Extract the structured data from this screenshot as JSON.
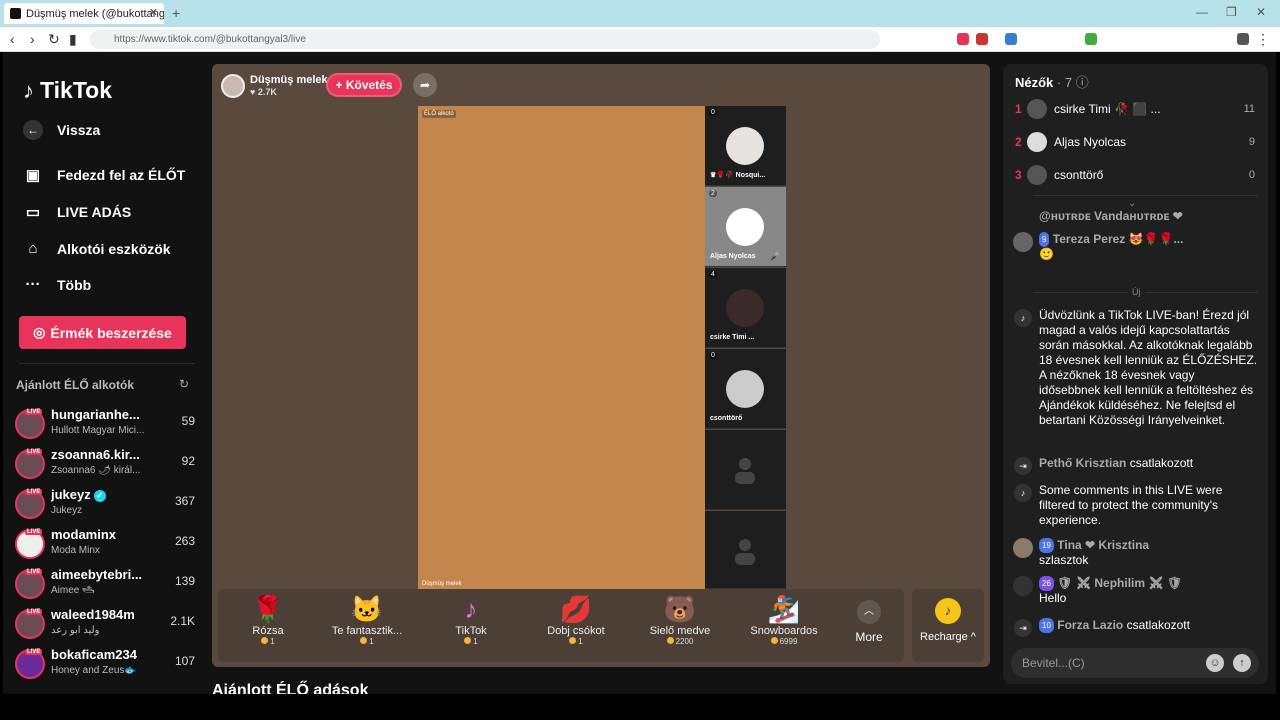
{
  "browser": {
    "tab_title": "Düşmüş melek (@bukottangy",
    "url": "https://www.tiktok.com/@bukottangyal3/live"
  },
  "sidebar": {
    "logo": "TikTok",
    "back": "Vissza",
    "menu": [
      {
        "label": "Fedezd fel az ÉLŐT",
        "icon": "tv-icon"
      },
      {
        "label": "LIVE ADÁS",
        "icon": "camera-icon"
      },
      {
        "label": "Alkotói eszközök",
        "icon": "creator-tools-icon"
      },
      {
        "label": "Több",
        "icon": "more-icon"
      }
    ],
    "coins_button": "Érmék beszerzése",
    "recommended_title": "Ajánlott ÉLŐ alkotók",
    "live_badge": "LIVE",
    "creators": [
      {
        "name": "hungarianhe...",
        "sub": "Hullott Magyar Mici...",
        "count": "59"
      },
      {
        "name": "zsoanna6.kir...",
        "sub": "Zsoanna6 🌶 királ...",
        "count": "92"
      },
      {
        "name": "jukeyz",
        "sub": "Jukeyz",
        "count": "367",
        "verified": true
      },
      {
        "name": "modaminx",
        "sub": "Moda Minx",
        "count": "263"
      },
      {
        "name": "aimeebytebri...",
        "sub": "Aimee 🛥",
        "count": "139"
      },
      {
        "name": "waleed1984m",
        "sub": "وليد ابو رعد",
        "count": "2.1K"
      },
      {
        "name": "bokaficam234",
        "sub": "Honey and Zeus🐟",
        "count": "107"
      }
    ]
  },
  "stream": {
    "host_name": "Düşmüş melek",
    "host_likes": "♥ 2.7K",
    "follow_label": "+ Követés",
    "live_tag": "ÉLŐ alkotó",
    "video_name": "Düşmüş melek",
    "guests": [
      {
        "count": "0",
        "name": "♛🌹🥀 Nosqui..."
      },
      {
        "count": "2",
        "name": "Aljas Nyolcas"
      },
      {
        "count": "4",
        "name": "csirke Timi ..."
      },
      {
        "count": "0",
        "name": "csonttörő"
      },
      {
        "count": "",
        "name": ""
      },
      {
        "count": "",
        "name": ""
      }
    ],
    "gifts": [
      {
        "label": "Rózsa",
        "price": "1",
        "icon": "🌹"
      },
      {
        "label": "Te fantasztik...",
        "price": "1",
        "icon": "🐱"
      },
      {
        "label": "TikTok",
        "price": "1",
        "icon": "♪"
      },
      {
        "label": "Dobj csókot",
        "price": "1",
        "icon": "💋"
      },
      {
        "label": "Sielő medve",
        "price": "2200",
        "icon": "🐻"
      },
      {
        "label": "Snowboardos",
        "price": "6999",
        "icon": "🏂"
      }
    ],
    "more_label": "More",
    "recharge_label": "Recharge ^"
  },
  "recommended_live": "Ajánlott ÉLŐ adások",
  "chat": {
    "viewers_label": "Nézők",
    "viewers_count": "· 7",
    "top_viewers": [
      {
        "rank": "1",
        "name": "csirke Timi 🥀 ⬛ ...",
        "score": "11"
      },
      {
        "rank": "2",
        "name": "Aljas Nyolcas",
        "score": "9"
      },
      {
        "rank": "3",
        "name": "csonttörő",
        "score": "0"
      }
    ],
    "messages": [
      {
        "user": "@ʜᴜᴛʀᴅᴇ Vandaʜᴜᴛʀᴅᴇ ❤",
        "text": ""
      },
      {
        "user": "Tereza Perez 😻🌹🌹...",
        "level": "9",
        "text": "🙂"
      },
      {
        "user": "",
        "text": "Üdvözlünk a TikTok LIVE-ban! Érezd jól magad a valós idejű kapcsolattartás során másokkal. Az alkotóknak legalább 18 évesnek kell lenniük az ÉLŐZÉSHEZ. A nézőknek 18 évesnek vagy idősebbnek kell lenniük a feltöltéshez és Ajándékok küldéséhez. Ne felejtsd el betartani Közösségi Irányelveinket."
      },
      {
        "user": "Pethő Krisztian",
        "text": "csatlakozott"
      },
      {
        "user": "",
        "text": "Some comments in this LIVE were filtered to protect the community's experience."
      },
      {
        "user": "Tina ❤ Krisztina",
        "level": "19",
        "text": "szlasztok"
      },
      {
        "user": "🛡 ⚔ Nephilim ⚔ 🛡",
        "level": "26",
        "text": "Hello"
      },
      {
        "user": "Forza Lazio",
        "level": "10",
        "text": "csatlakozott"
      }
    ],
    "new_label": "Új",
    "input_placeholder": "Bevitel...(C)"
  },
  "colors": {
    "accent": "#e8345a",
    "stage": "#5a4a3e",
    "video": "#c2854c"
  }
}
